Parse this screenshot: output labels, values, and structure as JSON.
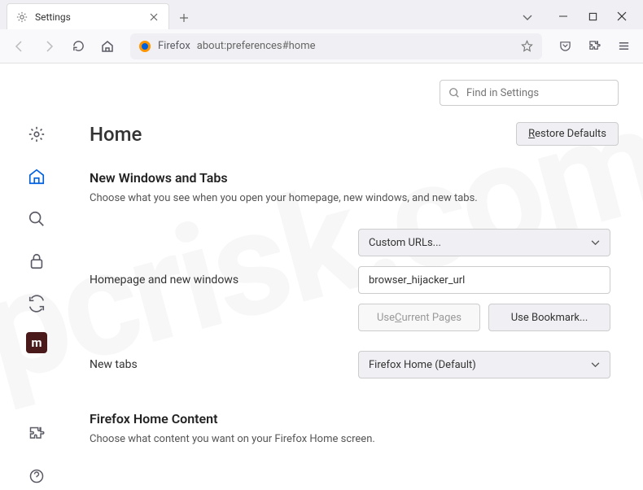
{
  "tab": {
    "title": "Settings"
  },
  "urlbar": {
    "label": "Firefox",
    "url": "about:preferences#home"
  },
  "search": {
    "placeholder": "Find in Settings"
  },
  "page": {
    "title": "Home",
    "restore_label": "Restore Defaults"
  },
  "section1": {
    "title": "New Windows and Tabs",
    "desc": "Choose what you see when you open your homepage, new windows, and new tabs."
  },
  "homepage": {
    "label": "Homepage and new windows",
    "select": "Custom URLs...",
    "input_value": "browser_hijacker_url",
    "use_current": "Use Current Pages",
    "use_bookmark": "Use Bookmark..."
  },
  "newtabs": {
    "label": "New tabs",
    "select": "Firefox Home (Default)"
  },
  "section2": {
    "title": "Firefox Home Content",
    "desc": "Choose what content you want on your Firefox Home screen."
  },
  "sidebar": {
    "maroon_letter": "m"
  }
}
